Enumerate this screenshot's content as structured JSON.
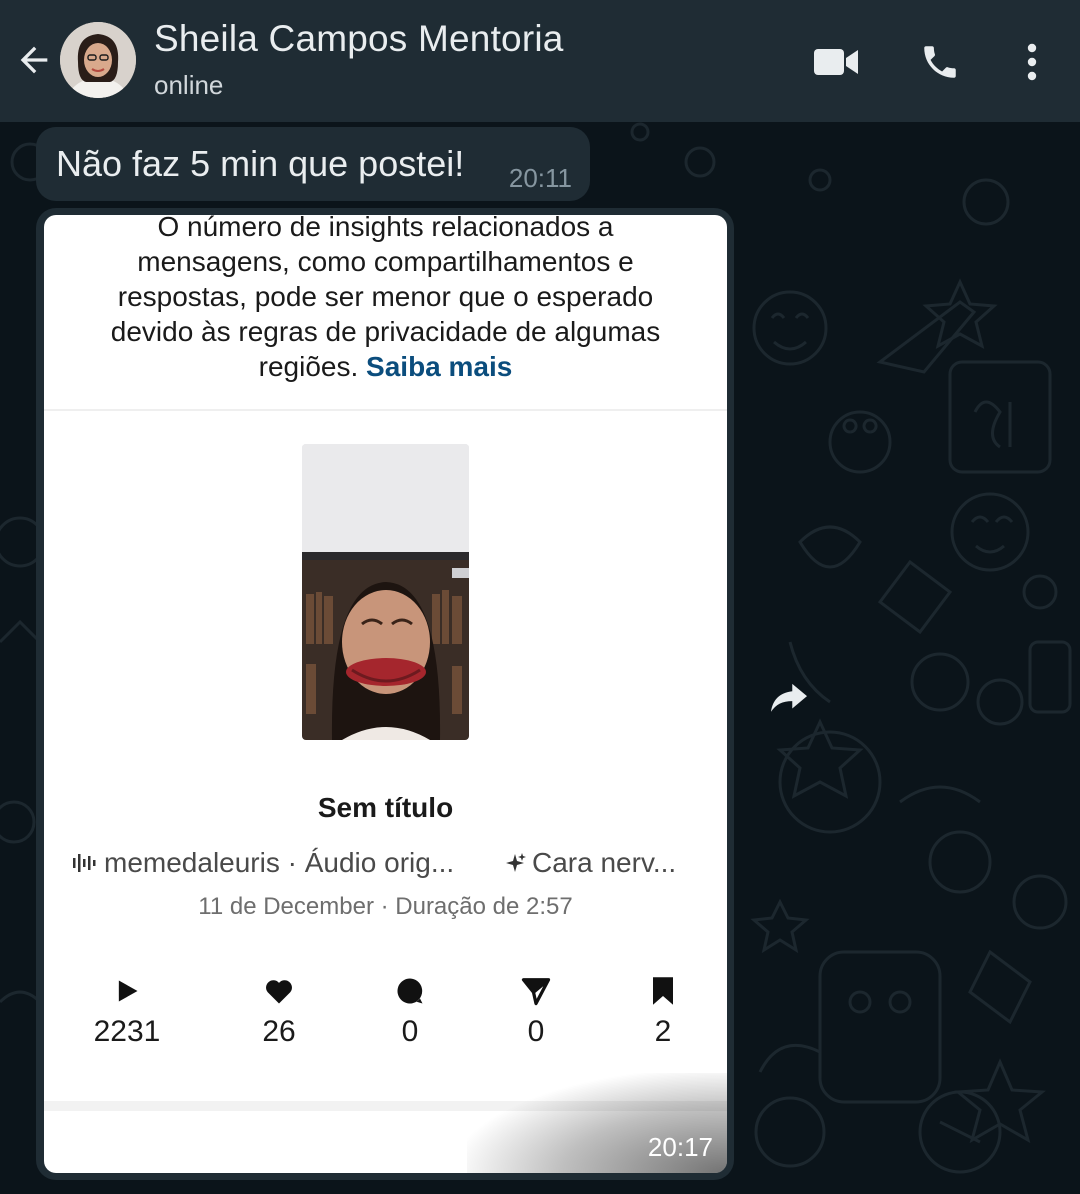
{
  "header": {
    "contact_name": "Sheila Campos Mentoria",
    "status": "online",
    "icons": [
      "back-arrow-icon",
      "video-call-icon",
      "voice-call-icon",
      "more-options-icon"
    ]
  },
  "colors": {
    "header_bg": "#1f2c34",
    "chat_bg": "#0b141a",
    "incoming_bubble": "#1f2c34",
    "link_blue": "#0b4d7d"
  },
  "messages": {
    "text_message": {
      "text": "Não faz 5 min que postei!",
      "time": "20:11"
    },
    "image_message": {
      "time": "20:17"
    }
  },
  "screenshot": {
    "notice_text": "O número de insights relacionados a mensagens, como compartilhamentos e respostas, pode ser menor que o esperado devido às regras de privacidade de algumas regiões.",
    "notice_link": "Saiba mais",
    "post_title": "Sem título",
    "audio_label": "memedaleuris · Áudio orig...",
    "effect_label": "Cara nerv...",
    "date_line": "11 de December · Duração de 2:57",
    "stats": {
      "plays": "2231",
      "likes": "26",
      "comments": "0",
      "shares": "0",
      "saves": "2"
    }
  }
}
